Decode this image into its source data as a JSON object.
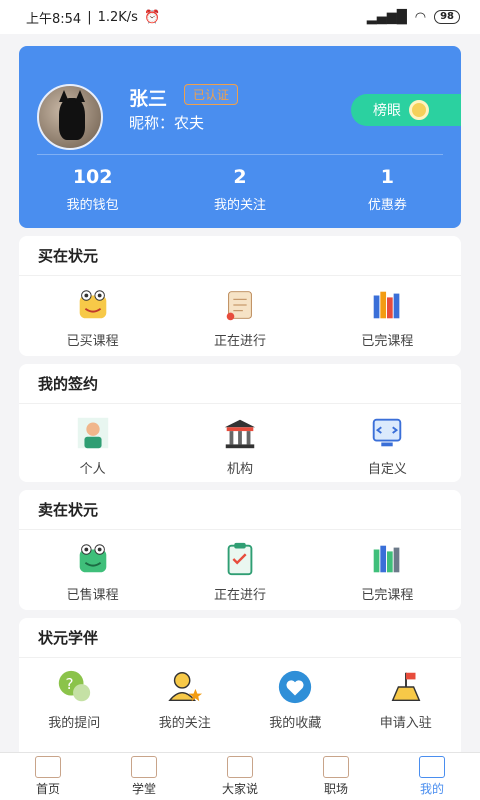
{
  "status_bar": {
    "time": "上午8:54",
    "speed": "1.2K/s",
    "battery": "98"
  },
  "profile": {
    "name": "张三",
    "verified": "已认证",
    "nickname": "昵称：农夫",
    "rank_button": "榜眼",
    "stats": [
      {
        "value": "102",
        "label": "我的钱包"
      },
      {
        "value": "2",
        "label": "我的关注"
      },
      {
        "value": "1",
        "label": "优惠券"
      }
    ]
  },
  "sections": [
    {
      "title": "买在状元",
      "items": [
        "已买课程",
        "正在进行",
        "已完课程"
      ]
    },
    {
      "title": "我的签约",
      "items": [
        "个人",
        "机构",
        "自定义"
      ]
    },
    {
      "title": "卖在状元",
      "items": [
        "已售课程",
        "正在进行",
        "已完课程"
      ]
    },
    {
      "title": "状元学伴",
      "items": [
        "我的提问",
        "我的关注",
        "我的收藏",
        "申请入驻"
      ]
    }
  ],
  "bottom_nav": [
    {
      "label": "首页"
    },
    {
      "label": "学堂"
    },
    {
      "label": "大家说"
    },
    {
      "label": "职场"
    },
    {
      "label": "我的"
    }
  ],
  "colors": {
    "primary": "#4a8eef",
    "rank": "#2bd1a0",
    "badge": "#f0a04b"
  }
}
